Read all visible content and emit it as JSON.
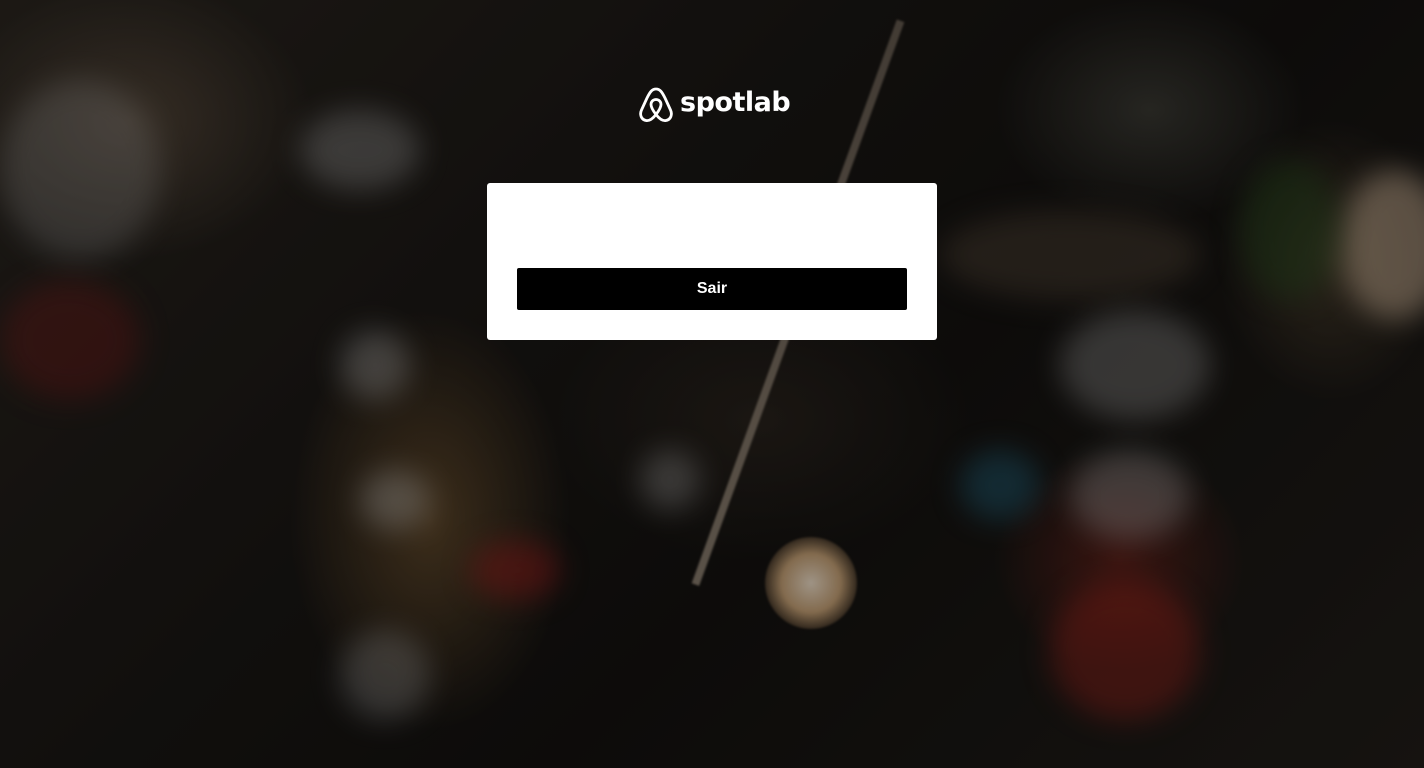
{
  "brand": {
    "name": "spotlab",
    "logo_icon": "airbnb-belo-icon"
  },
  "card": {
    "logout_label": "Sair"
  },
  "colors": {
    "button_bg": "#000000",
    "button_text": "#ffffff",
    "card_bg": "#ffffff"
  }
}
